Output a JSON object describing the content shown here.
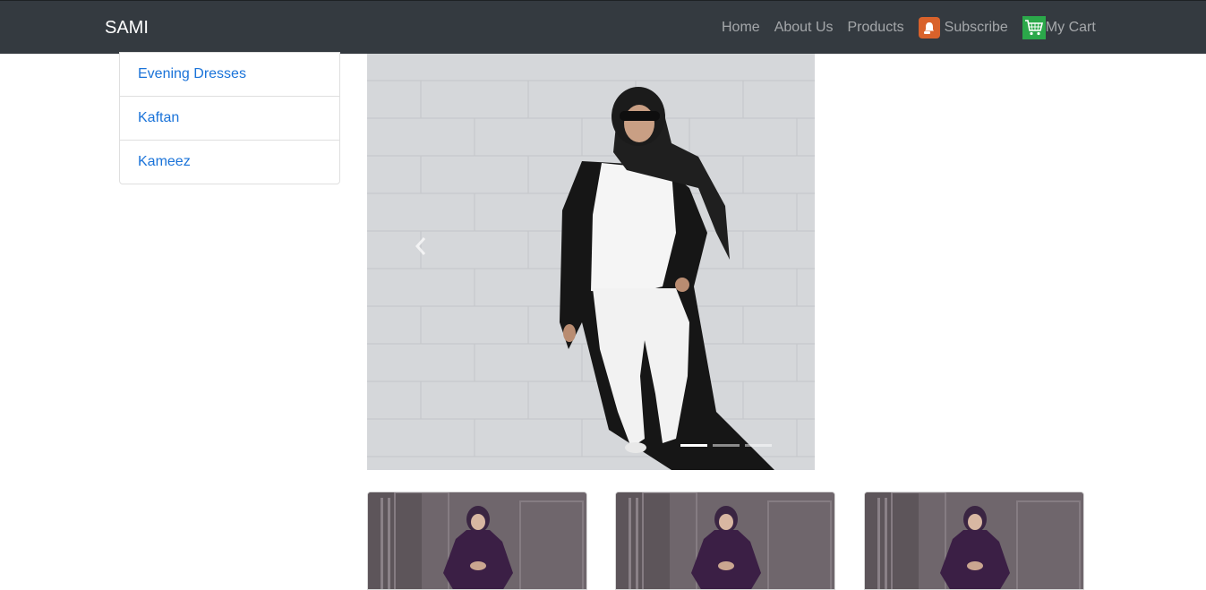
{
  "navbar": {
    "brand": "SAMI",
    "links": {
      "home": "Home",
      "about": "About Us",
      "products": "Products",
      "subscribe": "Subscribe",
      "cart": "My Cart"
    },
    "icons": {
      "subscribe": "bell-icon",
      "cart": "shopping-cart-icon"
    }
  },
  "sidebar": {
    "items": [
      {
        "label": "Evening Dresses"
      },
      {
        "label": "Kaftan"
      },
      {
        "label": "Kameez"
      }
    ]
  },
  "carousel": {
    "slide_count": 3,
    "active_index": 0,
    "prev_icon": "chevron-left-icon"
  },
  "products": [
    {
      "image": "product-image"
    },
    {
      "image": "product-image"
    },
    {
      "image": "product-image"
    }
  ],
  "colors": {
    "navbar": "#343a40",
    "link": "#1a73d9",
    "subscribe_icon": "#d9622b",
    "cart_icon": "#2ba84a"
  }
}
